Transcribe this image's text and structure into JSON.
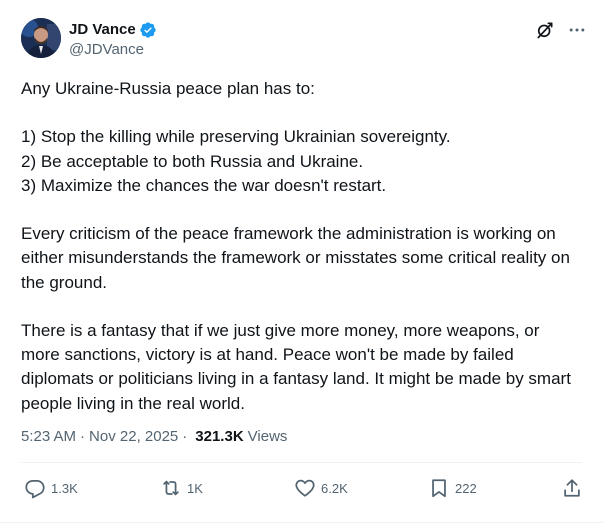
{
  "author": {
    "display_name": "JD Vance",
    "handle": "@JDVance",
    "verified": true
  },
  "post": {
    "text": "Any Ukraine-Russia peace plan has to:\n\n1) Stop the killing while preserving Ukrainian sovereignty.\n2) Be acceptable to both Russia and Ukraine.\n3) Maximize the chances the war doesn't restart.\n\nEvery criticism of the peace framework the administration is working on either misunderstands the framework or misstates some critical reality on the ground.\n\nThere is a fantasy that if we just give more money, more weapons, or more sanctions, victory is at hand. Peace won't be made by failed diplomats or politicians living in a fantasy land. It might be made by smart people living in the real world.",
    "time": "5:23 AM",
    "separator": "·",
    "date": "Nov 22, 2025",
    "views_count": "321.3K",
    "views_label": "Views"
  },
  "actions": {
    "reply": {
      "icon": "reply-icon",
      "count": "1.3K"
    },
    "repost": {
      "icon": "repost-icon",
      "count": "1K"
    },
    "like": {
      "icon": "heart-icon",
      "count": "6.2K"
    },
    "bookmark": {
      "icon": "bookmark-icon",
      "count": "222"
    },
    "share": {
      "icon": "share-icon"
    }
  },
  "header_icons": [
    "grok-icon",
    "more-icon"
  ],
  "colors": {
    "text_primary": "#0f1419",
    "text_secondary": "#536471",
    "verified_blue": "#1d9bf0",
    "divider": "#eff3f4"
  }
}
